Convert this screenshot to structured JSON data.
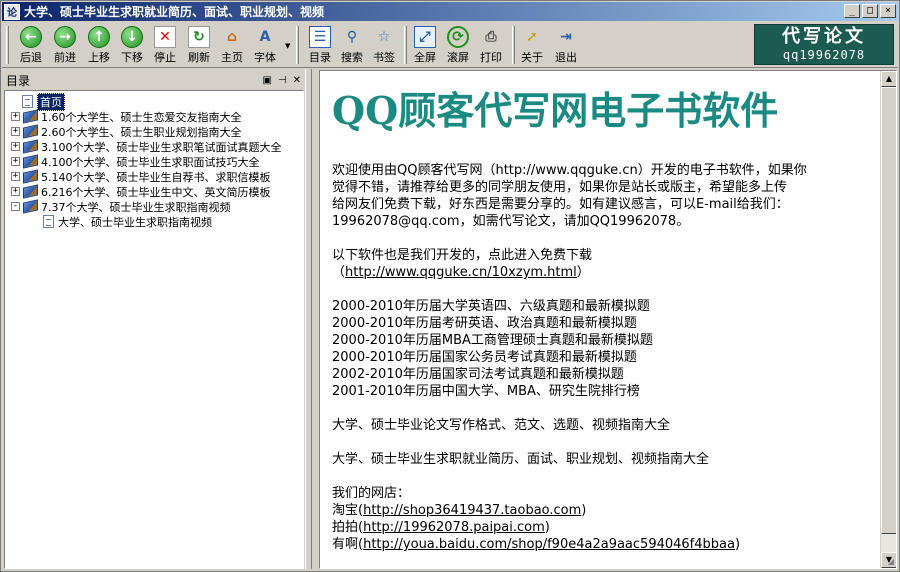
{
  "window": {
    "icon_text": "论",
    "title": "大学、硕士毕业生求职就业简历、面试、职业规划、视频",
    "buttons": [
      "_",
      "□",
      "×"
    ]
  },
  "toolbar": {
    "items": [
      {
        "label": "后退",
        "icon": "back-arrow-icon",
        "glyph": "←"
      },
      {
        "label": "前进",
        "icon": "forward-arrow-icon",
        "glyph": "→"
      },
      {
        "label": "上移",
        "icon": "up-arrow-icon",
        "glyph": "↑"
      },
      {
        "label": "下移",
        "icon": "down-arrow-icon",
        "glyph": "↓"
      },
      {
        "label": "停止",
        "icon": "stop-icon",
        "glyph": "✕"
      },
      {
        "label": "刷新",
        "icon": "refresh-icon",
        "glyph": "↻"
      },
      {
        "label": "主页",
        "icon": "home-icon",
        "glyph": "⌂"
      },
      {
        "label": "字体",
        "icon": "font-icon",
        "glyph": "A"
      },
      {
        "label": "目录",
        "icon": "contents-icon",
        "glyph": "☰"
      },
      {
        "label": "搜索",
        "icon": "search-icon",
        "glyph": "⚲"
      },
      {
        "label": "书签",
        "icon": "bookmark-star-icon",
        "glyph": "☆"
      },
      {
        "label": "全屏",
        "icon": "fullscreen-icon",
        "glyph": "⤢"
      },
      {
        "label": "滚屏",
        "icon": "autoscroll-icon",
        "glyph": "⟳"
      },
      {
        "label": "打印",
        "icon": "printer-icon",
        "glyph": "⎙"
      },
      {
        "label": "关于",
        "icon": "about-pointer-icon",
        "glyph": "➚"
      },
      {
        "label": "退出",
        "icon": "exit-icon",
        "glyph": "⇥"
      }
    ],
    "brand_title": "代写论文",
    "brand_qq": "qq19962078"
  },
  "sidebar": {
    "header": "目录",
    "tree": [
      {
        "label": "首页",
        "type": "page",
        "level": 0,
        "selected": true
      },
      {
        "label": "1.60个大学生、硕士生恋爱交友指南大全",
        "type": "book",
        "level": 0,
        "expander": "+"
      },
      {
        "label": "2.60个大学生、硕士生职业规划指南大全",
        "type": "book",
        "level": 0,
        "expander": "+"
      },
      {
        "label": "3.100个大学、硕士毕业生求职笔试面试真题大全",
        "type": "book",
        "level": 0,
        "expander": "+"
      },
      {
        "label": "4.100个大学、硕士毕业生求职面试技巧大全",
        "type": "book",
        "level": 0,
        "expander": "+"
      },
      {
        "label": "5.140个大学、硕士毕业生自荐书、求职信模板",
        "type": "book",
        "level": 0,
        "expander": "+"
      },
      {
        "label": "6.216个大学、硕士毕业生中文、英文简历模板",
        "type": "book",
        "level": 0,
        "expander": "+"
      },
      {
        "label": "7.37个大学、硕士毕业生求职指南视频",
        "type": "book",
        "level": 0,
        "expander": "-"
      },
      {
        "label": "大学、硕士毕业生求职指南视频",
        "type": "page",
        "level": 1
      }
    ]
  },
  "content": {
    "heading": "QQ顾客代写网电子书软件",
    "intro_lines": [
      "欢迎使用由QQ顾客代写网（http://www.qqguke.cn）开发的电子书软件，如果你",
      "觉得不错，请推荐给更多的同学朋友使用，如果你是站长或版主，希望能多上传",
      "给网友们免费下载，好东西是需要分享的。如有建议感言，可以E-mail给我们：",
      "19962078@qq.com，如需代写论文，请加QQ19962078。"
    ],
    "intro_link": "http://www.qqguke.cn",
    "download_text": "以下软件也是我们开发的，点此进入免费下载",
    "download_link": "http://www.qqguke.cn/10xzym.html",
    "software_list": [
      "2000-2010年历届大学英语四、六级真题和最新模拟题",
      "2000-2010年历届考研英语、政治真题和最新模拟题",
      "2000-2010年历届MBA工商管理硕士真题和最新模拟题",
      "2000-2010年历届国家公务员考试真题和最新模拟题",
      "2002-2010年历届国家司法考试真题和最新模拟题",
      "2001-2010年历届中国大学、MBA、研究生院排行榜"
    ],
    "thesis_text": "大学、硕士毕业论文写作格式、范文、选题、视频指南大全",
    "job_text": "大学、硕士毕业生求职就业简历、面试、职业规划、视频指南大全",
    "shops_heading": "我们的网店：",
    "shops": [
      {
        "name": "淘宝",
        "url": "http://shop36419437.taobao.com"
      },
      {
        "name": "拍拍",
        "url": "http://19962078.paipai.com"
      },
      {
        "name": "有啊",
        "url": "http://youa.baidu.com/shop/f90e4a2a9aac594046f4bbaa"
      }
    ]
  }
}
